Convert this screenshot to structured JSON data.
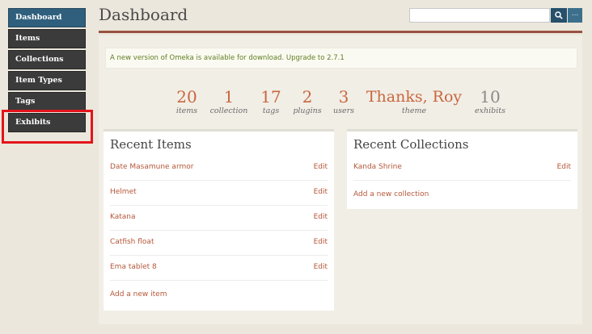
{
  "sidebar": {
    "items": [
      {
        "label": "Dashboard",
        "active": true
      },
      {
        "label": "Items"
      },
      {
        "label": "Collections"
      },
      {
        "label": "Item Types"
      },
      {
        "label": "Tags"
      },
      {
        "label": "Exhibits"
      }
    ]
  },
  "header": {
    "title": "Dashboard",
    "search": {
      "value": "",
      "placeholder": ""
    },
    "search_button_icon": "search-icon",
    "advanced_label": "..."
  },
  "notice": {
    "text": "A new version of Omeka is available for download.",
    "link_text": "Upgrade to 2.7.1"
  },
  "stats": [
    {
      "value": "20",
      "label": "items"
    },
    {
      "value": "1",
      "label": "collection"
    },
    {
      "value": "17",
      "label": "tags"
    },
    {
      "value": "2",
      "label": "plugins"
    },
    {
      "value": "3",
      "label": "users"
    },
    {
      "value": "Thanks, Roy",
      "label": "theme"
    },
    {
      "value": "10",
      "label": "exhibits"
    }
  ],
  "recent_items": {
    "title": "Recent Items",
    "rows": [
      {
        "name": "Date Masamune armor",
        "edit": "Edit"
      },
      {
        "name": "Helmet",
        "edit": "Edit"
      },
      {
        "name": "Katana",
        "edit": "Edit"
      },
      {
        "name": "Catfish float",
        "edit": "Edit"
      },
      {
        "name": "Ema tablet 8",
        "edit": "Edit"
      }
    ],
    "add_link": "Add a new item"
  },
  "recent_collections": {
    "title": "Recent Collections",
    "rows": [
      {
        "name": "Kanda Shrine",
        "edit": "Edit"
      }
    ],
    "add_link": "Add a new collection"
  },
  "colors": {
    "accent": "#b5573a",
    "active_nav": "#2f5f7d",
    "nav": "#3b3b3b",
    "highlight": "#e3141b",
    "notice_text": "#5e7f22"
  }
}
